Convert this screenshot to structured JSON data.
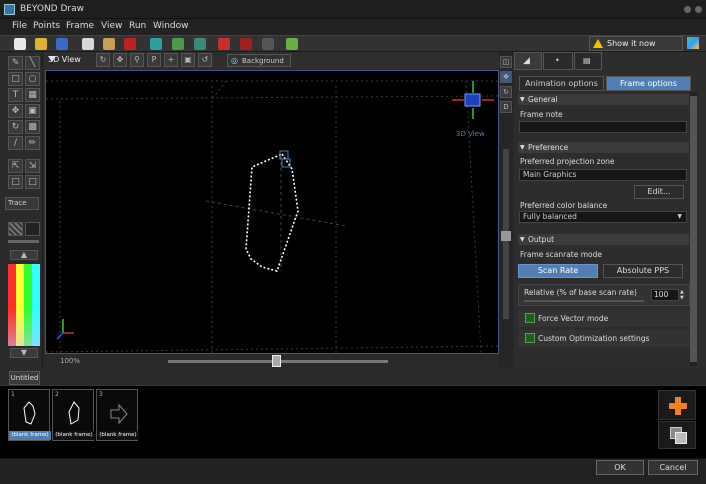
{
  "window": {
    "title": "BEYOND Draw"
  },
  "menu": [
    "File",
    "Points",
    "Frame",
    "View",
    "Run",
    "Window"
  ],
  "toolbar": {
    "show_it_now": "Show it now"
  },
  "left_tools": {
    "trace_label": "Trace"
  },
  "view": {
    "label": "3D View",
    "background_label": "Background",
    "zoom_label": "100%",
    "axes_widget_label": "3D View"
  },
  "right_panel": {
    "tabs": [
      "Animation options",
      "Frame options"
    ],
    "general": {
      "header": "General",
      "frame_note_label": "Frame note",
      "frame_note_value": ""
    },
    "preference": {
      "header": "Preference",
      "projection_zone_label": "Preferred projection zone",
      "projection_zone_value": "Main Graphics",
      "edit_button": "Edit...",
      "color_balance_label": "Preferred color balance",
      "color_balance_value": "Fully balanced"
    },
    "output": {
      "header": "Output",
      "scanrate_mode_label": "Frame scanrate mode",
      "scan_rate_button": "Scan Rate",
      "absolute_pps_button": "Absolute PPS",
      "relative_label": "Relative (% of base scan rate)",
      "relative_value": "100",
      "force_vector_label": "Force Vector mode",
      "custom_opt_label": "Custom Optimization settings"
    }
  },
  "frames": {
    "tab_label": "Untitled",
    "items": [
      {
        "num": "1",
        "label": "(blank frame)"
      },
      {
        "num": "2",
        "label": "(blank frame)"
      },
      {
        "num": "3",
        "label": "(blank frame)"
      }
    ]
  },
  "dialog": {
    "ok": "OK",
    "cancel": "Cancel"
  },
  "colors": {
    "accent": "#4f7fb5",
    "viewport_border": "#46558a",
    "warning": "#f2c400",
    "add_orange": "#f08020"
  }
}
